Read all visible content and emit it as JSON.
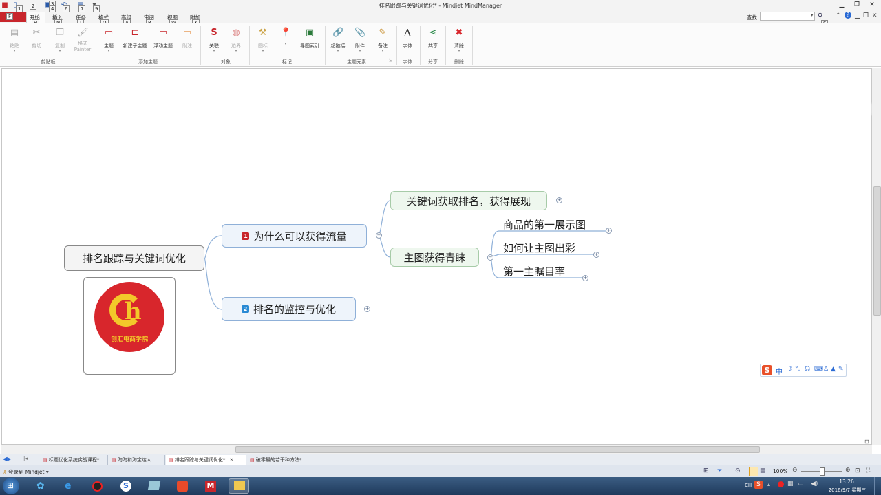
{
  "window": {
    "title": "排名跟踪与关键词优化* - Mindjet MindManager",
    "search_label": "查找:",
    "search_value": "",
    "search_keytip": "S"
  },
  "qat": {
    "keytips": [
      "1",
      "2",
      "3",
      "4",
      "6",
      "7",
      "9"
    ]
  },
  "tabs": [
    {
      "label": "开始",
      "keytip": "H"
    },
    {
      "label": "插入",
      "keytip": "N"
    },
    {
      "label": "任务",
      "keytip": "T"
    },
    {
      "label": "格式",
      "keytip": "O"
    },
    {
      "label": "高级",
      "keytip": "A"
    },
    {
      "label": "审阅",
      "keytip": "R"
    },
    {
      "label": "视图",
      "keytip": "W"
    },
    {
      "label": "附加",
      "keytip": "X"
    }
  ],
  "file_tab": {
    "keytip": "F"
  },
  "ribbon": {
    "buttons": {
      "paste": "粘贴",
      "cut": "剪切",
      "copy": "复制",
      "format_painter": "格式\nPainter",
      "topic": "主题",
      "new_subtopic": "新建子主题",
      "floating_topic": "浮动主题",
      "callout": "附注",
      "relationship": "关联",
      "boundary": "边界",
      "icon": "图标",
      "map_index": "导图索引",
      "hyperlink": "超链接",
      "attachment": "附件",
      "notes": "备注",
      "font": "字体",
      "share": "共享",
      "clear": "清除"
    },
    "groups": {
      "clipboard": "剪贴板",
      "add_topic": "添加主题",
      "objects": "对象",
      "markers": "标记",
      "topic_elements": "主题元素",
      "font": "字体",
      "share": "分享",
      "delete": "删除"
    }
  },
  "map": {
    "central": "排名跟踪与关键词优化",
    "logo_text": "创汇电商学院",
    "main_topics": [
      {
        "number": "1",
        "label": "为什么可以获得流量",
        "color": "#c8262c"
      },
      {
        "number": "2",
        "label": "排名的监控与优化",
        "color": "#2a8ad4"
      }
    ],
    "subtopics": [
      {
        "label": "关键词获取排名，获得展现"
      },
      {
        "label": "主图获得青睐"
      }
    ],
    "leaves": [
      {
        "label": "商品的第一展示图"
      },
      {
        "label": "如何让主图出彩"
      },
      {
        "label": "第一主瞩目率"
      }
    ],
    "collapse_symbol": "−",
    "expand_symbol": "+"
  },
  "doc_tabs": [
    {
      "label": "标题优化系统实战课程*"
    },
    {
      "label": "淘淘和淘宝达人"
    },
    {
      "label": "排名跟踪与关键词优化*",
      "active": true
    },
    {
      "label": "破零最的若干种方法*"
    }
  ],
  "status": {
    "login": "登录到 Mindjet",
    "zoom": "100%"
  },
  "taskbar": {
    "lang": "CH",
    "time": "13:26",
    "date": "2016/9/7 星期三"
  },
  "ime": {
    "label": "中"
  }
}
